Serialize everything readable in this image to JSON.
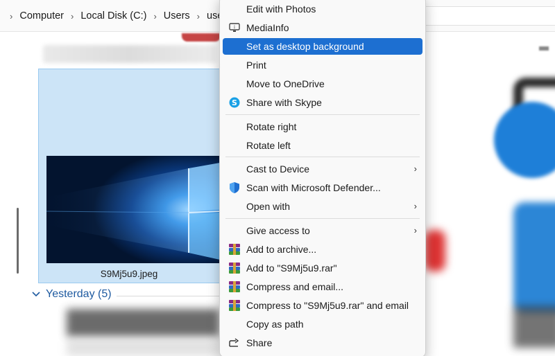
{
  "breadcrumb": {
    "items": [
      "Computer",
      "Local Disk (C:)",
      "Users",
      "user"
    ],
    "separator": "›"
  },
  "file": {
    "name": "S9Mj5u9.jpeg"
  },
  "group": {
    "label": "Yesterday (5)"
  },
  "colors": {
    "selection": "#1d6fd1",
    "tile_selected": "#cce4f7",
    "group_header": "#1e5aa0"
  },
  "context_menu": {
    "items": [
      {
        "label": "Edit with Photos",
        "icon": ""
      },
      {
        "label": "MediaInfo",
        "icon": "mediainfo-icon"
      },
      {
        "label": "Set as desktop background",
        "icon": "",
        "selected": true
      },
      {
        "label": "Print",
        "icon": ""
      },
      {
        "label": "Move to OneDrive",
        "icon": ""
      },
      {
        "label": "Share with Skype",
        "icon": "skype-icon"
      },
      {
        "label": "Rotate right",
        "icon": ""
      },
      {
        "label": "Rotate left",
        "icon": ""
      },
      {
        "label": "Cast to Device",
        "icon": "",
        "submenu": true
      },
      {
        "label": "Scan with Microsoft Defender...",
        "icon": "defender-shield-icon"
      },
      {
        "label": "Open with",
        "icon": "",
        "submenu": true
      },
      {
        "label": "Give access to",
        "icon": "",
        "submenu": true
      },
      {
        "label": "Add to archive...",
        "icon": "winrar-icon"
      },
      {
        "label": "Add to \"S9Mj5u9.rar\"",
        "icon": "winrar-icon"
      },
      {
        "label": "Compress and email...",
        "icon": "winrar-icon"
      },
      {
        "label": "Compress to \"S9Mj5u9.rar\" and email",
        "icon": "winrar-icon"
      },
      {
        "label": "Copy as path",
        "icon": ""
      },
      {
        "label": "Share",
        "icon": "share-icon"
      }
    ],
    "submenu_arrow": "›"
  }
}
